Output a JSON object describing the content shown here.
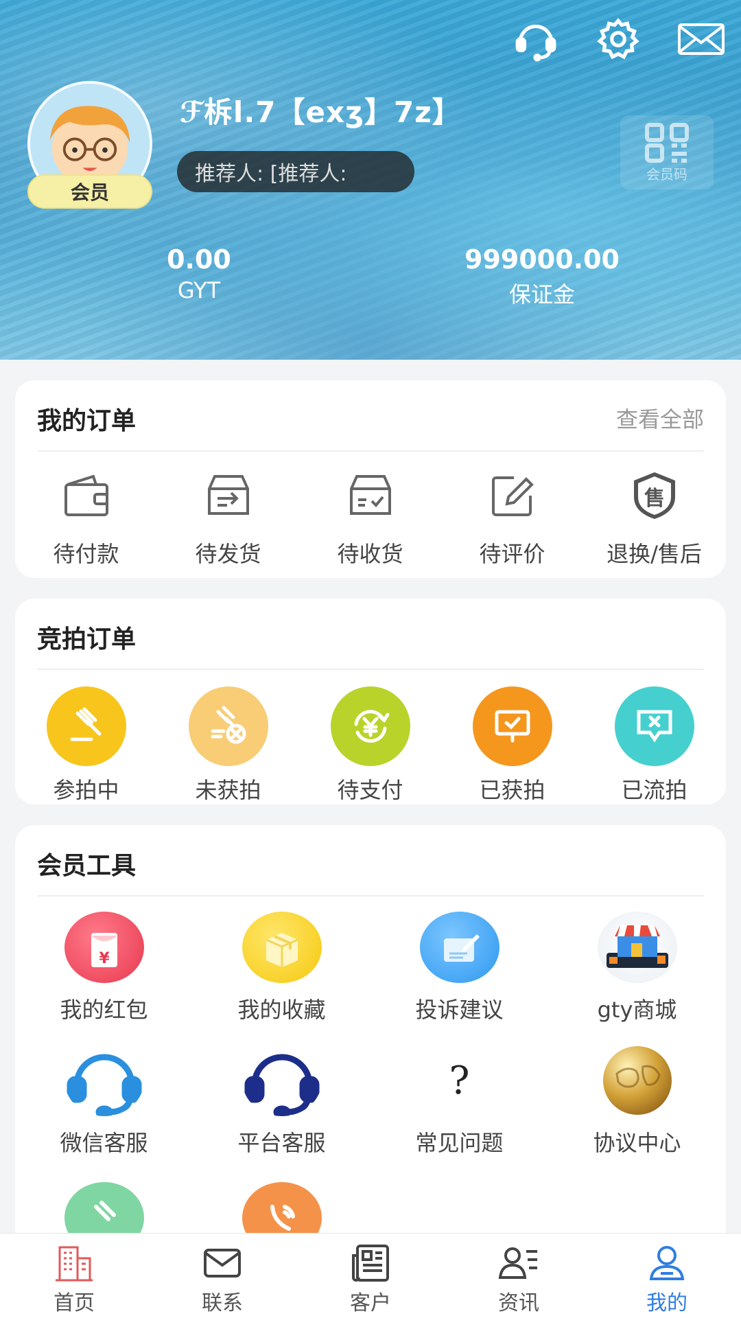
{
  "header": {
    "user_name": "ℱ柝l.7【exʒ】7z】",
    "member_badge": "会员",
    "referrer": "推荐人: [推荐人:",
    "qr_label": "会员码",
    "stats": [
      {
        "value": "0.00",
        "label": "GYT"
      },
      {
        "value": "999000.00",
        "label": "保证金"
      }
    ]
  },
  "my_orders": {
    "title": "我的订单",
    "view_all": "查看全部",
    "items": [
      {
        "label": "待付款",
        "icon": "wallet-icon"
      },
      {
        "label": "待发货",
        "icon": "ship-box-icon"
      },
      {
        "label": "待收货",
        "icon": "receive-box-icon"
      },
      {
        "label": "待评价",
        "icon": "edit-icon"
      },
      {
        "label": "退换/售后",
        "icon": "shield-sale-icon"
      }
    ]
  },
  "auction_orders": {
    "title": "竞拍订单",
    "items": [
      {
        "label": "参拍中",
        "icon": "gavel-icon",
        "color": "#f7c51c"
      },
      {
        "label": "未获拍",
        "icon": "gavel-cancel-icon",
        "color": "#f8cd76"
      },
      {
        "label": "待支付",
        "icon": "yen-refresh-icon",
        "color": "#b9d32a"
      },
      {
        "label": "已获拍",
        "icon": "screen-check-icon",
        "color": "#f5961d"
      },
      {
        "label": "已流拍",
        "icon": "message-close-icon",
        "color": "#45d0cf"
      }
    ]
  },
  "member_tools": {
    "title": "会员工具",
    "items": [
      {
        "label": "我的红包",
        "icon": "red-packet-icon"
      },
      {
        "label": "我的收藏",
        "icon": "box-icon"
      },
      {
        "label": "投诉建议",
        "icon": "feedback-icon"
      },
      {
        "label": "gty商城",
        "icon": "store-icon"
      },
      {
        "label": "微信客服",
        "icon": "headset-blue-icon"
      },
      {
        "label": "平台客服",
        "icon": "headset-navy-icon"
      },
      {
        "label": "常见问题",
        "icon": "question-icon",
        "glyph": "?"
      },
      {
        "label": "协议中心",
        "icon": "globe-icon"
      }
    ]
  },
  "bottom_nav": [
    {
      "label": "首页",
      "icon": "building-icon"
    },
    {
      "label": "联系",
      "icon": "mail-icon"
    },
    {
      "label": "客户",
      "icon": "newspaper-icon"
    },
    {
      "label": "资讯",
      "icon": "person-list-icon"
    },
    {
      "label": "我的",
      "icon": "user-icon",
      "active": true
    }
  ],
  "colors": {
    "accent": "#2f7de1",
    "header_blue": "#3aa7d6",
    "badge_yellow": "#f6efa6"
  }
}
